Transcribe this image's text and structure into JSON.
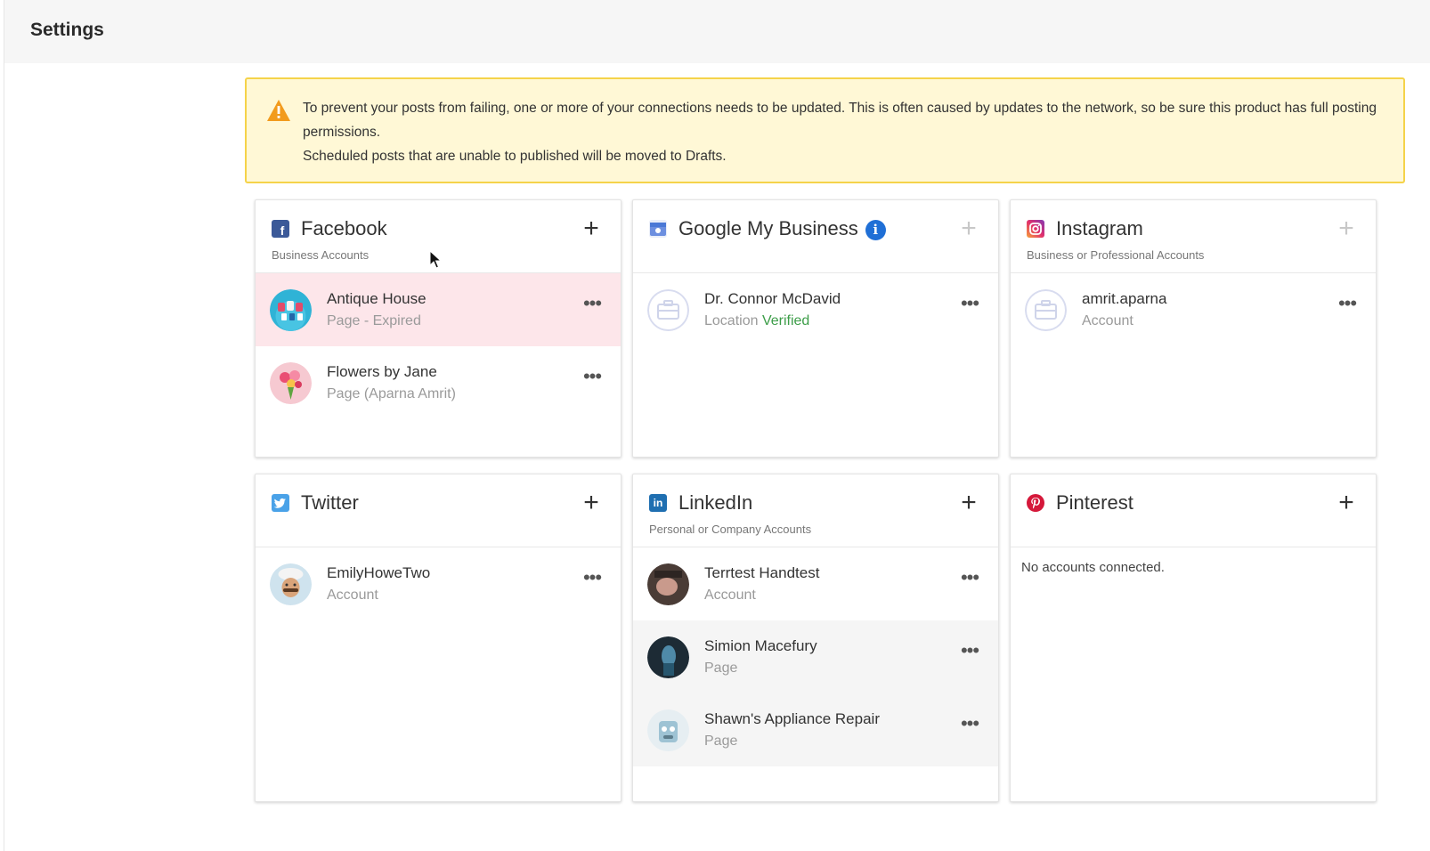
{
  "header": {
    "title": "Settings"
  },
  "alert": {
    "line1": "To prevent your posts from failing, one or more of your connections needs to be updated. This is often caused by updates to the network, so be sure this product has full posting permissions.",
    "line2": "Scheduled posts that are unable to published will be moved to Drafts."
  },
  "colors": {
    "facebook": "#3b5998",
    "google": "#4a78d6",
    "twitter": "#4aa2e8",
    "linkedin": "#1f6fb1",
    "pinterest": "#d5183a",
    "warning": "#f29b1d",
    "expired_bg": "#fde6ea",
    "verified": "#3c9d48"
  },
  "cards": {
    "facebook": {
      "title": "Facebook",
      "subtitle": "Business Accounts",
      "icon": "facebook-icon",
      "accounts": [
        {
          "name": "Antique House",
          "type": "Page - Expired",
          "status": "expired"
        },
        {
          "name": "Flowers by Jane",
          "type": "Page (Aparna Amrit)"
        }
      ]
    },
    "google": {
      "title": "Google My Business",
      "icon": "google-my-business-icon",
      "accounts": [
        {
          "name": "Dr. Connor McDavid",
          "type": "Location",
          "badge": "Verified"
        }
      ]
    },
    "instagram": {
      "title": "Instagram",
      "subtitle": "Business or Professional Accounts",
      "icon": "instagram-icon",
      "accounts": [
        {
          "name": "amrit.aparna",
          "type": "Account"
        }
      ]
    },
    "twitter": {
      "title": "Twitter",
      "icon": "twitter-icon",
      "accounts": [
        {
          "name": "EmilyHoweTwo",
          "type": "Account"
        }
      ]
    },
    "linkedin": {
      "title": "LinkedIn",
      "subtitle": "Personal or Company Accounts",
      "icon": "linkedin-icon",
      "accounts": [
        {
          "name": "Terrtest Handtest",
          "type": "Account"
        },
        {
          "name": "Simion Macefury",
          "type": "Page"
        },
        {
          "name": "Shawn's Appliance Repair",
          "type": "Page"
        }
      ]
    },
    "pinterest": {
      "title": "Pinterest",
      "icon": "pinterest-icon",
      "empty_text": "No accounts connected."
    }
  },
  "glyphs": {
    "add": "+",
    "more": "•••",
    "info": "i",
    "fb": "f",
    "li": "in"
  }
}
